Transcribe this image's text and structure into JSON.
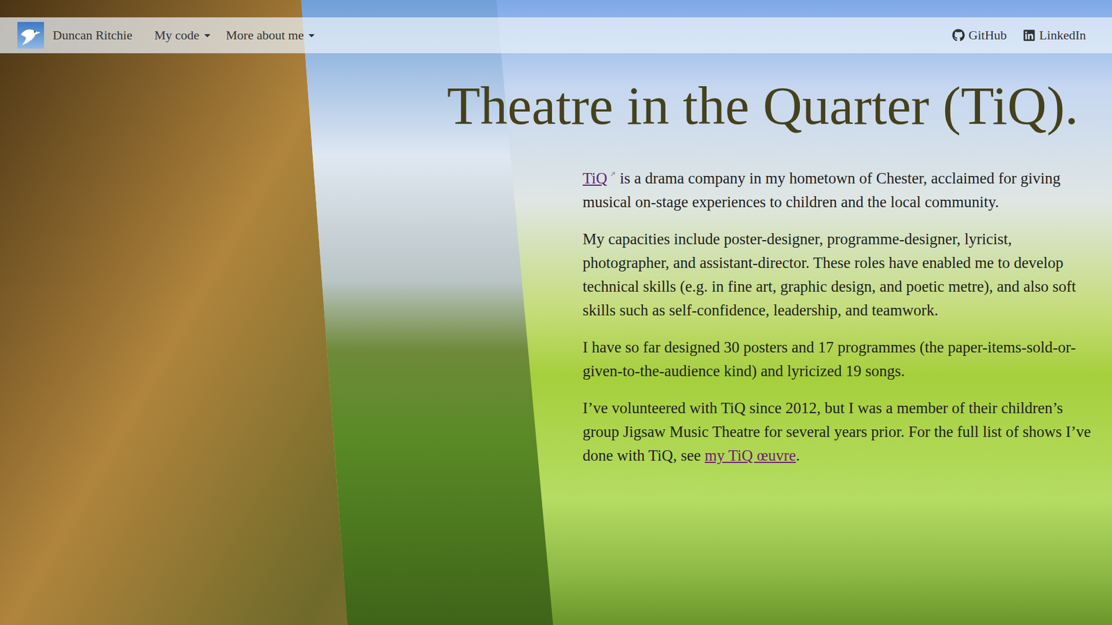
{
  "nav": {
    "brand": "Duncan Ritchie",
    "menus": [
      {
        "label": "My code",
        "expanded": false
      },
      {
        "label": "More about me",
        "expanded": false
      }
    ],
    "links": [
      {
        "label": "GitHub",
        "kind": "github"
      },
      {
        "label": "LinkedIn",
        "kind": "linkedin"
      }
    ]
  },
  "page": {
    "title": "Theatre in the Quarter (TiQ).",
    "paragraphs": [
      [
        {
          "text": "TiQ",
          "link": true,
          "external": true
        },
        {
          "text": " is a drama company in my hometown of Chester, acclaimed for giving musical on-stage experiences to children and the local community.",
          "link": false,
          "external": false
        }
      ],
      [
        {
          "text": "My capacities include poster-designer, programme-designer, lyricist, photographer, and assistant-director. These roles have enabled me to develop technical skills (e.g. in fine art, graphic design, and poetic metre), and also soft skills such as self-confidence, leadership, and teamwork.",
          "link": false,
          "external": false
        }
      ],
      [
        {
          "text": "I have so far designed 30 posters and 17 programmes (the paper-items-sold-or-given-to-the-audience kind) and lyricized 19 songs.",
          "link": false,
          "external": false
        }
      ],
      [
        {
          "text": "I’ve volunteered with TiQ since 2012, but I was a member of their children’s group Jigsaw Music Theatre for several years prior. For the full list of shows I’ve done with TiQ, see ",
          "link": false,
          "external": false
        },
        {
          "text": "my TiQ œuvre",
          "link": true,
          "external": false
        },
        {
          "text": ".",
          "link": false,
          "external": false
        }
      ]
    ]
  }
}
